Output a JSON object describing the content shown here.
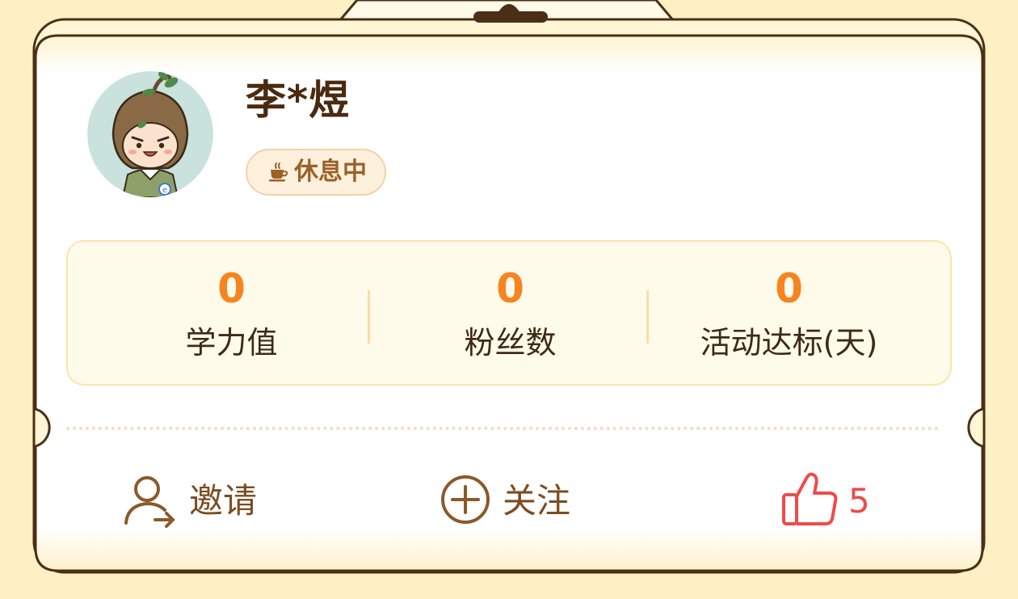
{
  "profile": {
    "name": "李*煜",
    "status": "休息中",
    "avatar_icon": "acorn-character-avatar"
  },
  "stats": [
    {
      "value": "0",
      "label": "学力值"
    },
    {
      "value": "0",
      "label": "粉丝数"
    },
    {
      "value": "0",
      "label": "活动达标(天)"
    }
  ],
  "actions": {
    "invite": {
      "label": "邀请",
      "icon": "user-invite-icon"
    },
    "follow": {
      "label": "关注",
      "icon": "plus-circle-icon"
    },
    "like": {
      "count": "5",
      "icon": "thumbs-up-icon"
    }
  },
  "colors": {
    "background": "#fdf0c4",
    "card": "#ffffff",
    "border": "#4a2f16",
    "accent_orange": "#f8841f",
    "action_brown": "#7a4c21",
    "like_red": "#ef4b4b"
  }
}
